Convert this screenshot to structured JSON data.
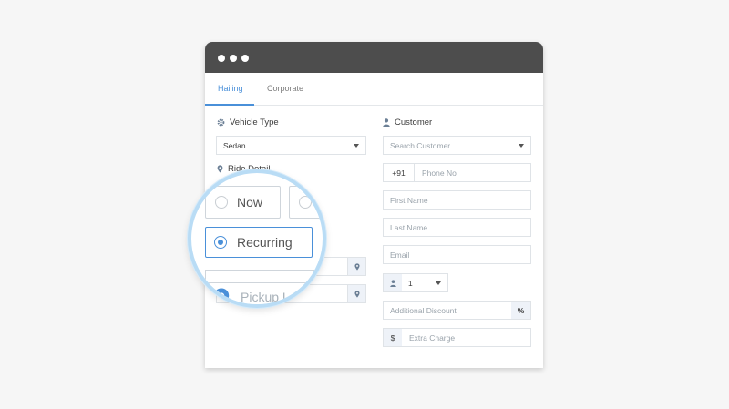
{
  "tabs": [
    {
      "label": "Hailing",
      "active": true
    },
    {
      "label": "Corporate",
      "active": false
    }
  ],
  "left": {
    "vehicle_type": {
      "label": "Vehicle Type",
      "icon": "gear-icon",
      "value": "Sedan"
    },
    "ride_detail": {
      "label": "Ride Detail",
      "icon": "map-pin-icon"
    },
    "ride_options": [
      {
        "label": "Now",
        "selected": false
      },
      {
        "label": "Recurring",
        "selected": true
      }
    ],
    "pickup_placeholder": "Pickup Lo"
  },
  "right": {
    "customer_label": "Customer",
    "customer_icon": "user-icon",
    "search_customer_placeholder": "Search Customer",
    "country_code": "+91",
    "phone_placeholder": "Phone No",
    "first_name_placeholder": "First Name",
    "last_name_placeholder": "Last Name",
    "email_placeholder": "Email",
    "passenger_count": "1",
    "additional_discount_placeholder": "Additional Discount",
    "discount_symbol": "%",
    "currency_symbol": "$",
    "extra_charge_placeholder": "Extra Charge"
  },
  "colors": {
    "accent": "#4a90d9",
    "titlebar": "#4d4d4d",
    "magnifier_ring": "#b9dcf5",
    "addon_bg": "#eef2f8"
  }
}
